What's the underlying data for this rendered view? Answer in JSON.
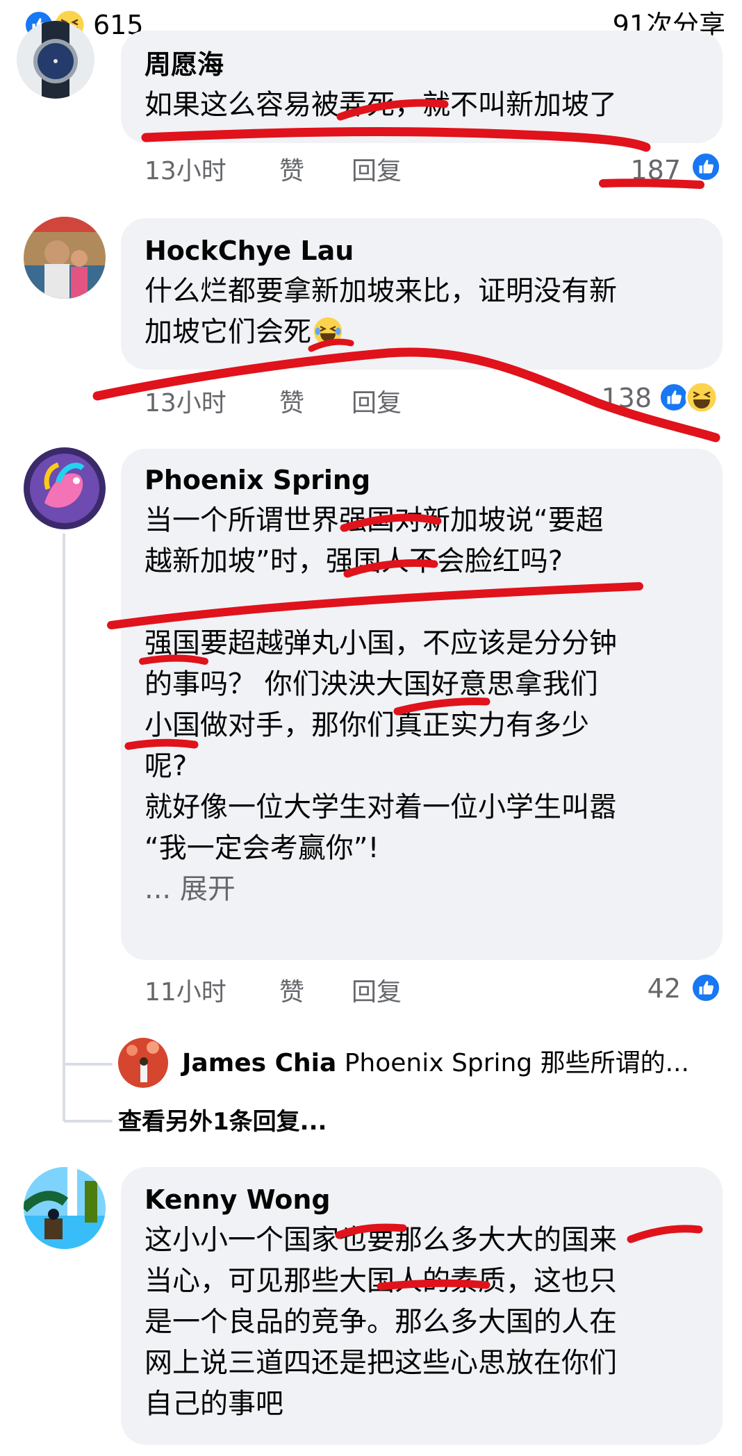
{
  "header": {
    "reaction_count": "615",
    "share_count": "91次分享"
  },
  "comments": [
    {
      "author": "周愿海",
      "lines": [
        "如果这么容易被弄死，就不叫新加坡了"
      ],
      "time": "13小时",
      "like_label": "赞",
      "reply_label": "回复",
      "reaction_count": "187"
    },
    {
      "author": "HockChye Lau",
      "lines": [
        "什么烂都要拿新加坡来比，证明没有新",
        "加坡它们会死"
      ],
      "time": "13小时",
      "like_label": "赞",
      "reply_label": "回复",
      "reaction_count": "138"
    },
    {
      "author": "Phoenix Spring",
      "lines": [
        "当一个所谓世界强国对新加坡说“要超",
        "越新加坡”时，强国人不会脸红吗?",
        "",
        "强国要超越弹丸小国，不应该是分分钟",
        "的事吗？ 你们泱泱大国好意思拿我们",
        "小国做对手，那你们真正实力有多少",
        "呢?",
        "就好像一位大学生对着一位小学生叫嚣",
        "“我一定会考赢你”!"
      ],
      "expand_label": "... 展开",
      "time": "11小时",
      "like_label": "赞",
      "reply_label": "回复",
      "reaction_count": "42",
      "reply": {
        "author": "James Chia",
        "preview": "Phoenix Spring 那些所谓的..."
      },
      "more_replies_label": "查看另外1条回复..."
    },
    {
      "author": "Kenny Wong",
      "lines": [
        "这小小一个国家也要那么多大大的国来",
        "当心，可见那些大国人的素质，这也只",
        "是一个良品的竞争。那么多大国的人在",
        "网上说三道四还是把这些心思放在你们",
        "自己的事吧"
      ]
    }
  ],
  "colors": {
    "accent": "#1877f2",
    "bubble": "#f0f2f5",
    "meta_text": "#65676b",
    "annotation": "#e0121b"
  }
}
